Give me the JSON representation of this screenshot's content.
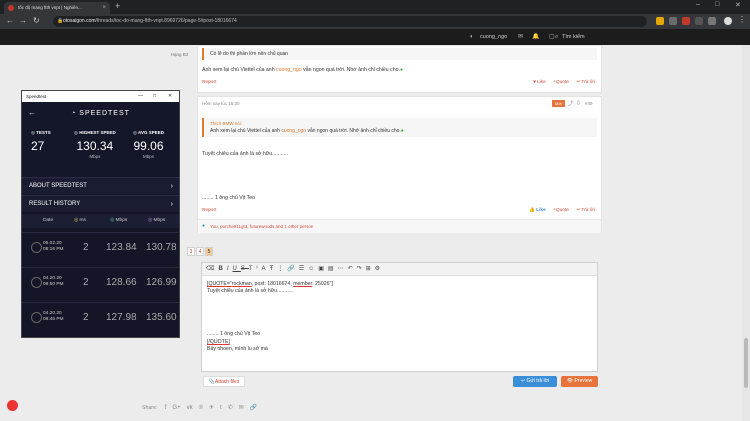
{
  "browser": {
    "tab_title": "tốc độ mạng ftth vnpt | Nghiên...",
    "tab_close": "×",
    "new_tab": "+",
    "url_host": "otosaigon.com",
    "url_path": "/threads/toc-do-mang-ftth-vnpt.8969726/page-5#post-18016674"
  },
  "site_header": {
    "username": "cuong_ngo",
    "search_label": "Tìm kiếm"
  },
  "post1": {
    "rank": "Hạng B2",
    "quote_text": "Có lẽ do thi phần lớn nên chủ quan",
    "body_pre": "Anh xem lại chú Viettel của anh ",
    "body_mention": "cuong_ngo",
    "body_post": " vẫn ngon quá trời. Nhớ ảnh chỉ chiều cho.",
    "report": "Report",
    "like": "Like",
    "quote": "+Quote",
    "reply": "Trả lời"
  },
  "post2": {
    "meta": "Hôm nay lúc 15:30",
    "badge": "Mới",
    "post_number": "#49",
    "quote_header": "Thích BMW nói:",
    "quote_pre": "Anh xem lại chú Viettel của anh ",
    "quote_mention": "cuong_ngo",
    "quote_post": " vẫn ngon quá trời. Nhớ ảnh chỉ chiều cho.",
    "body1": "Tuyệt chiêu của ảnh là sở hữu...........",
    "body2": "........ 1 ông chủ Vịt Teo",
    "report": "Report",
    "like": "Like",
    "quote": "+Quote",
    "reply": "Trả lời",
    "reactions": "You, porche911gt3, futurewoods and 1 other person"
  },
  "pagination": [
    "3",
    "4",
    "5"
  ],
  "editor": {
    "line1_pre": "[QUOTE=\"",
    "line1_user": "rockman",
    "line1_mid": ", post: 18016674, ",
    "line1_member": "member",
    "line1_end": ": 25026\"]",
    "line2": "Tuyệt chiêu của ảnh là sở hữu...........",
    "line3": "........ 1 ông chủ Vịt Teo",
    "line4": "[/QUOTE]",
    "line5": "Bảy nhoen, mình lu sở mà",
    "attach": "Attach files",
    "submit": "Gửi trả lời",
    "preview": "Preview"
  },
  "share": {
    "label": "Share:"
  },
  "speedtest": {
    "window_title": "Speedtest",
    "logo": "SPEEDTEST",
    "tests_label": "TESTS",
    "tests_value": "27",
    "highest_label": "HIGHEST SPEED",
    "highest_value": "130.34",
    "highest_unit": "Mbps",
    "avg_label": "AVG SPEED",
    "avg_value": "99.06",
    "avg_unit": "Mbps",
    "about": "ABOUT SPEEDTEST",
    "history": "RESULT HISTORY",
    "col_date": "Date",
    "col_ms": "ms",
    "col_down": "Mbps",
    "col_up": "Mbps",
    "rows": [
      {
        "date": "05.02.20",
        "time": "08:16 PM",
        "ms": "2",
        "down": "123.84",
        "up": "130.78"
      },
      {
        "date": "04.20.20",
        "time": "08:50 PM",
        "ms": "2",
        "down": "128.66",
        "up": "126.99"
      },
      {
        "date": "04.20.20",
        "time": "08:45 PM",
        "ms": "2",
        "down": "127.98",
        "up": "135.60"
      }
    ]
  },
  "colors": {
    "accent_orange": "#d9742c",
    "accent_red": "#d04b3b",
    "speedtest_bg": "#141526",
    "submit_blue": "#3b8ed8",
    "preview_orange": "#e8743b"
  }
}
